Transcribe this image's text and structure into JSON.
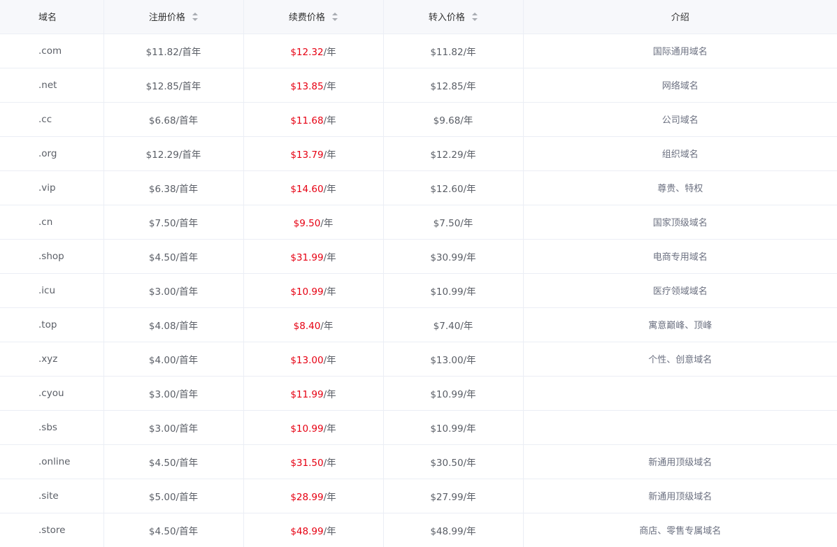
{
  "table": {
    "headers": {
      "domain": "域名",
      "register": "注册价格",
      "renew": "续费价格",
      "transfer": "转入价格",
      "intro": "介绍"
    },
    "rows": [
      {
        "domain": ".com",
        "register": "$11.82/首年",
        "renew_price": "$12.32",
        "renew_unit": "/年",
        "transfer": "$11.82/年",
        "intro": "国际通用域名"
      },
      {
        "domain": ".net",
        "register": "$12.85/首年",
        "renew_price": "$13.85",
        "renew_unit": "/年",
        "transfer": "$12.85/年",
        "intro": "网络域名"
      },
      {
        "domain": ".cc",
        "register": "$6.68/首年",
        "renew_price": "$11.68",
        "renew_unit": "/年",
        "transfer": "$9.68/年",
        "intro": "公司域名"
      },
      {
        "domain": ".org",
        "register": "$12.29/首年",
        "renew_price": "$13.79",
        "renew_unit": "/年",
        "transfer": "$12.29/年",
        "intro": "组织域名"
      },
      {
        "domain": ".vip",
        "register": "$6.38/首年",
        "renew_price": "$14.60",
        "renew_unit": "/年",
        "transfer": "$12.60/年",
        "intro": "尊贵、特权"
      },
      {
        "domain": ".cn",
        "register": "$7.50/首年",
        "renew_price": "$9.50",
        "renew_unit": "/年",
        "transfer": "$7.50/年",
        "intro": "国家顶级域名"
      },
      {
        "domain": ".shop",
        "register": "$4.50/首年",
        "renew_price": "$31.99",
        "renew_unit": "/年",
        "transfer": "$30.99/年",
        "intro": "电商专用域名"
      },
      {
        "domain": ".icu",
        "register": "$3.00/首年",
        "renew_price": "$10.99",
        "renew_unit": "/年",
        "transfer": "$10.99/年",
        "intro": "医疗领域域名"
      },
      {
        "domain": ".top",
        "register": "$4.08/首年",
        "renew_price": "$8.40",
        "renew_unit": "/年",
        "transfer": "$7.40/年",
        "intro": "寓意巅峰、顶峰"
      },
      {
        "domain": ".xyz",
        "register": "$4.00/首年",
        "renew_price": "$13.00",
        "renew_unit": "/年",
        "transfer": "$13.00/年",
        "intro": "个性、创意域名"
      },
      {
        "domain": ".cyou",
        "register": "$3.00/首年",
        "renew_price": "$11.99",
        "renew_unit": "/年",
        "transfer": "$10.99/年",
        "intro": ""
      },
      {
        "domain": ".sbs",
        "register": "$3.00/首年",
        "renew_price": "$10.99",
        "renew_unit": "/年",
        "transfer": "$10.99/年",
        "intro": ""
      },
      {
        "domain": ".online",
        "register": "$4.50/首年",
        "renew_price": "$31.50",
        "renew_unit": "/年",
        "transfer": "$30.50/年",
        "intro": "新通用顶级域名"
      },
      {
        "domain": ".site",
        "register": "$5.00/首年",
        "renew_price": "$28.99",
        "renew_unit": "/年",
        "transfer": "$27.99/年",
        "intro": "新通用顶级域名"
      },
      {
        "domain": ".store",
        "register": "$4.50/首年",
        "renew_price": "$48.99",
        "renew_unit": "/年",
        "transfer": "$48.99/年",
        "intro": "商店、零售专属域名"
      }
    ]
  },
  "colors": {
    "header_bg": "#f7f8fb",
    "border": "#ebeef5",
    "text": "#5a5e66",
    "renew_price": "#e60012"
  },
  "icons": {
    "sort": "sort-caret-icon"
  }
}
